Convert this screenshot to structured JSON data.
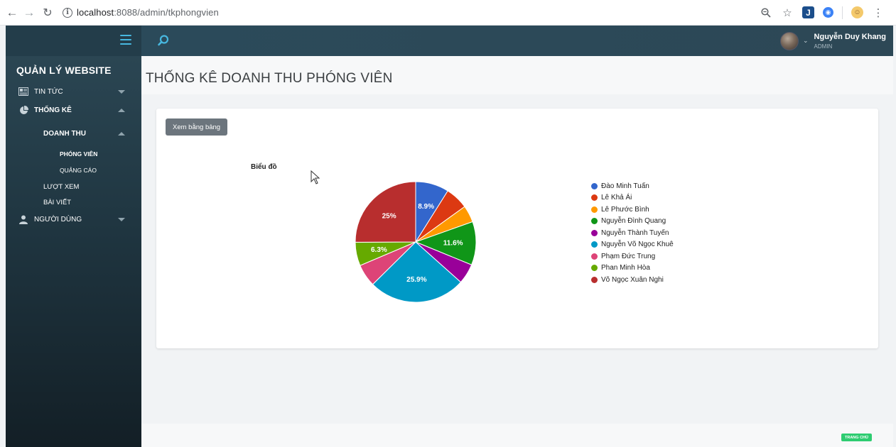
{
  "browser": {
    "url_host": "localhost",
    "url_path": ":8088/admin/tkphongvien"
  },
  "header": {
    "user_name": "Nguyễn Duy Khang",
    "user_role": "ADMIN"
  },
  "sidebar": {
    "brand": "QUẢN LÝ WEBSITE",
    "items": [
      {
        "label": "TIN TỨC"
      },
      {
        "label": "THỐNG KÊ"
      },
      {
        "label": "DOANH THU"
      },
      {
        "label": "PHÓNG VIÊN"
      },
      {
        "label": "QUẢNG CÁO"
      },
      {
        "label": "LƯỢT XEM"
      },
      {
        "label": "BÀI VIẾT"
      },
      {
        "label": "NGƯỜI DÙNG"
      }
    ]
  },
  "main": {
    "page_title": "THỐNG KÊ DOANH THU PHÓNG VIÊN",
    "table_button": "Xem bằng bảng",
    "chart_heading": "Biểu đồ"
  },
  "footer": {
    "home_label": "TRANG CHỦ"
  },
  "colors": {
    "accent": "#47b8e0",
    "sidebar": "#233d4a",
    "home_badge": "#2ecc71"
  },
  "chart_data": {
    "type": "pie",
    "title": "Biểu đồ",
    "legend_position": "right",
    "series": [
      {
        "name": "Đào Minh Tuấn",
        "value": 8.9,
        "color": "#3366cc",
        "label": "8.9%"
      },
      {
        "name": "Lê Khả Ái",
        "value": 6.1,
        "color": "#dc3912",
        "label": ""
      },
      {
        "name": "Lê Phước Bình",
        "value": 4.5,
        "color": "#ff9900",
        "label": ""
      },
      {
        "name": "Nguyễn Đình Quang",
        "value": 11.6,
        "color": "#109618",
        "label": "11.6%"
      },
      {
        "name": "Nguyễn Thành Tuyến",
        "value": 5.4,
        "color": "#990099",
        "label": ""
      },
      {
        "name": "Nguyễn Võ Ngọc Khuê",
        "value": 25.9,
        "color": "#0099c6",
        "label": "25.9%"
      },
      {
        "name": "Phạm Đức Trung",
        "value": 6.0,
        "color": "#dd4477",
        "label": ""
      },
      {
        "name": "Phan Minh Hòa",
        "value": 6.3,
        "color": "#66aa00",
        "label": "6.3%"
      },
      {
        "name": "Võ Ngọc Xuân Nghi",
        "value": 25.0,
        "color": "#b82e2e",
        "label": "25%"
      }
    ]
  }
}
